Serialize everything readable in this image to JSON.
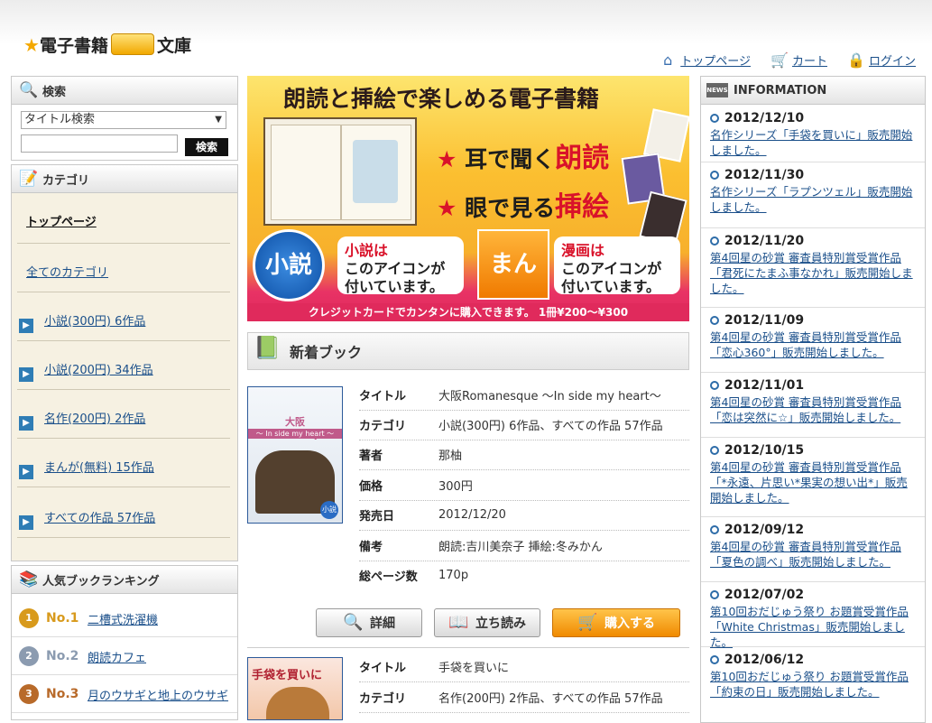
{
  "header": {
    "logo_left": "電子書籍",
    "logo_right": "文庫",
    "nav": [
      {
        "label": "トップページ",
        "icon": "home-icon"
      },
      {
        "label": "カート",
        "icon": "cart-icon"
      },
      {
        "label": "ログイン",
        "icon": "lock-icon"
      }
    ]
  },
  "search": {
    "title": "検索",
    "select_value": "タイトル検索",
    "input_value": "",
    "button_label": "検索"
  },
  "category": {
    "title": "カテゴリ",
    "top_link": "トップページ",
    "all_link": "全てのカテゴリ",
    "items": [
      "小説(300円) 6作品",
      "小説(200円) 34作品",
      "名作(200円) 2作品",
      "まんが(無料) 15作品",
      "すべての作品 57作品"
    ]
  },
  "ranking": {
    "title": "人気ブックランキング",
    "items": [
      {
        "no": "No.1",
        "title": "二槽式洗濯機",
        "color": "#d89a1c"
      },
      {
        "no": "No.2",
        "title": "朗読カフェ",
        "color": "#8b9bb0"
      },
      {
        "no": "No.3",
        "title": "月のウサギと地上のウサギ",
        "color": "#b86a2a"
      }
    ]
  },
  "banner": {
    "title": "朗読と挿絵で楽しめる電子書籍",
    "feature1_prefix": "耳で聞く",
    "feature1_highlight": "朗読",
    "feature2_prefix": "眼で見る",
    "feature2_highlight": "挿絵",
    "novel_badge": "小説",
    "novel_bubble_1": "小説は",
    "novel_bubble_2": "このアイコンが",
    "novel_bubble_3": "付いています。",
    "manga_badge": "まんが",
    "manga_bubble_1": "漫画は",
    "manga_bubble_2": "このアイコンが",
    "manga_bubble_3": "付いています。",
    "strip": "クレジットカードでカンタンに購入できます。 1冊¥200〜¥300"
  },
  "new_books": {
    "title": "新着ブック",
    "labels": {
      "title": "タイトル",
      "category": "カテゴリ",
      "author": "著者",
      "price": "価格",
      "release": "発売日",
      "note": "備考",
      "pages": "総ページ数"
    },
    "book1": {
      "title": "大阪Romanesque 〜In side my heart〜",
      "category": "小説(300円) 6作品、すべての作品 57作品",
      "author": "那柚",
      "price": "300円",
      "release": "2012/12/20",
      "note": "朗読:吉川美奈子 挿絵:冬みかん",
      "pages": "170p",
      "cover_title": "大阪 Romanesque",
      "cover_subtitle": "〜 In side my heart 〜",
      "cover_badge": "小説"
    },
    "book2": {
      "title": "手袋を買いに",
      "category": "名作(200円) 2作品、すべての作品 57作品",
      "cover_title": "手袋を買いに"
    },
    "buttons": {
      "detail": "詳細",
      "tachiyomi": "立ち読み",
      "buy": "購入する"
    }
  },
  "information": {
    "title": "INFORMATION",
    "news_icon_label": "NEWS",
    "items": [
      {
        "date": "2012/12/10",
        "text": "名作シリーズ「手袋を買いに」販売開始しました。"
      },
      {
        "date": "2012/11/30",
        "text": "名作シリーズ「ラプンツェル」販売開始しました。"
      },
      {
        "date": "2012/11/20",
        "text": "第4回星の砂賞 審査員特別賞受賞作品「君死にたまふ事なかれ」販売開始しました。"
      },
      {
        "date": "2012/11/09",
        "text": "第4回星の砂賞 審査員特別賞受賞作品「恋心360°」販売開始しました。"
      },
      {
        "date": "2012/11/01",
        "text": "第4回星の砂賞 審査員特別賞受賞作品「恋は突然に☆」販売開始しました。"
      },
      {
        "date": "2012/10/15",
        "text": "第4回星の砂賞 審査員特別賞受賞作品「*永遠、片思い*果実の想い出*」販売開始しました。"
      },
      {
        "date": "2012/09/12",
        "text": "第4回星の砂賞 審査員特別賞受賞作品「夏色の調べ」販売開始しました。"
      },
      {
        "date": "2012/07/02",
        "text": "第10回おだじゅう祭り お題賞受賞作品「White Christmas」販売開始しました。"
      },
      {
        "date": "2012/06/12",
        "text": "第10回おだじゅう祭り お題賞受賞作品「約束の日」販売開始しました。"
      }
    ]
  }
}
